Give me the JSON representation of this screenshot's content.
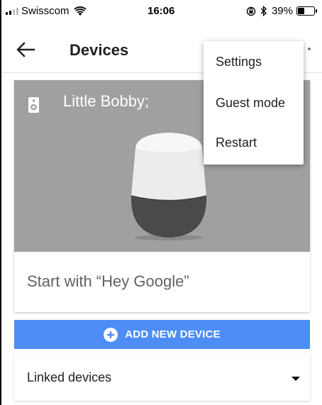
{
  "status_bar": {
    "carrier": "Swisscom",
    "time": "16:06",
    "battery": "39%",
    "battery_level": 0.39,
    "icons": [
      "signal-icon",
      "wifi-icon",
      "orientation-lock-icon",
      "bluetooth-icon",
      "battery-icon"
    ]
  },
  "app_bar": {
    "title": "Devices",
    "back_icon": "arrow-back-icon"
  },
  "device_card": {
    "name": "Little Bobby;",
    "icon": "speaker-icon",
    "prompt": "Start with “Hey Google”"
  },
  "add_button": {
    "label": "ADD NEW DEVICE",
    "icon": "add-circle-icon",
    "color": "#4d8df5"
  },
  "linked_devices": {
    "label": "Linked devices",
    "icon": "dropdown-arrow-icon"
  },
  "menu": {
    "items": [
      {
        "label": "Settings"
      },
      {
        "label": "Guest mode"
      },
      {
        "label": "Restart"
      }
    ]
  },
  "colors": {
    "hero_background": "#a0a0a0",
    "accent": "#4d8df5"
  }
}
